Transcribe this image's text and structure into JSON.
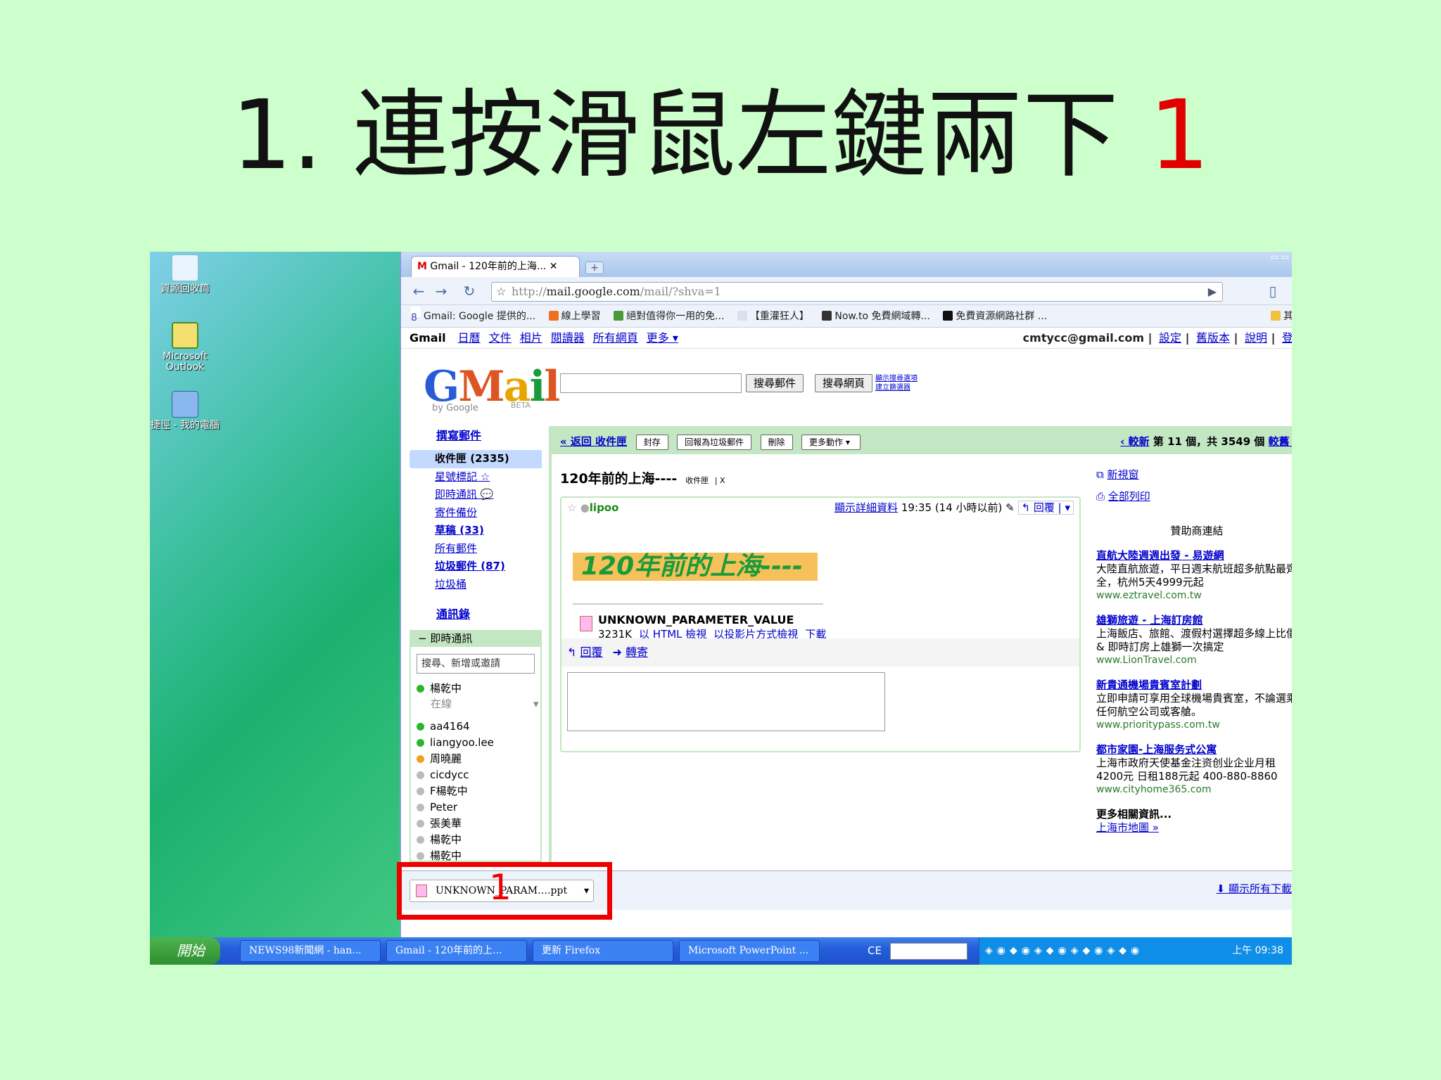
{
  "slide": {
    "title": "1. 連按滑鼠左鍵兩下 ",
    "title_number": "1"
  },
  "desktop": {
    "icons": [
      "資源回收筒",
      "Microsoft Outlook",
      "捷徑 - 我的電腦"
    ]
  },
  "browser": {
    "tab_title": "Gmail - 120年前的上海...",
    "url_prefix": "http://",
    "url_host": "mail.google.com",
    "url_path": "/mail/?shva=1",
    "bookmarks": [
      "Gmail: Google 提供的...",
      "線上學習",
      "絕對值得你一用的免...",
      "【重灌狂人】",
      "Now.to 免費網域轉...",
      "免費資源網路社群 ...",
      "其"
    ]
  },
  "gmail": {
    "gbar_links": [
      "日曆",
      "文件",
      "相片",
      "閱讀器",
      "所有網頁",
      "更多 ▾"
    ],
    "gbar_brand": "Gmail",
    "user_email": "cmtycc@gmail.com",
    "user_links": [
      "設定",
      "舊版本",
      "說明",
      "登"
    ],
    "logo": {
      "by": "by Google",
      "beta": "BETA"
    },
    "search_mail_btn": "搜尋郵件",
    "search_web_btn": "搜尋網頁",
    "search_opts": [
      "顯示搜尋選項",
      "建立篩選器"
    ],
    "compose": "撰寫郵件",
    "nav": [
      {
        "label": "收件匣 (2335)",
        "sel": true
      },
      {
        "label": "星號標記 ☆"
      },
      {
        "label": "即時通訊 💬"
      },
      {
        "label": "寄件備份"
      },
      {
        "label": "草稿 (33)",
        "bold": true
      },
      {
        "label": "所有郵件"
      },
      {
        "label": "垃圾郵件 (87)",
        "bold": true
      },
      {
        "label": "垃圾桶"
      }
    ],
    "contacts": "通訊錄",
    "chat": {
      "header": "−  即時通訊",
      "search_placeholder": "搜尋、新增或邀請",
      "me_name": "楊乾中",
      "me_status": "在線",
      "list": [
        {
          "name": "aa4164",
          "status": "on"
        },
        {
          "name": "liangyoo.lee",
          "status": "on"
        },
        {
          "name": "周曉麗",
          "status": "idle"
        },
        {
          "name": "cicdycc",
          "status": "off"
        },
        {
          "name": "F楊乾中",
          "status": "off"
        },
        {
          "name": "Peter",
          "status": "off"
        },
        {
          "name": "張美華",
          "status": "off"
        },
        {
          "name": "楊乾中",
          "status": "off"
        },
        {
          "name": "楊乾中",
          "status": "off"
        }
      ]
    },
    "toolbar": {
      "back": "« 返回 收件匣",
      "archive": "封存",
      "spam": "回報為垃圾郵件",
      "delete": "刪除",
      "more": "更多動作 ▾",
      "pager_newer": "‹ 較新",
      "pager_text": " 第 11 個，共 3549 個 ",
      "pager_older": "較舊 ›"
    },
    "message": {
      "subject": "120年前的上海----",
      "label": "收件匣",
      "label_x": "| X",
      "sender": "lipoo",
      "details_link": "顯示詳細資料",
      "time": " 19:35 (14 小時以前)",
      "reply_btn": "↰ 回覆 | ▾",
      "banner": "120年前的上海----",
      "attachment_name": "UNKNOWN_PARAMETER_VALUE",
      "attachment_size": "3231K",
      "attachment_links": [
        "以 HTML 檢視",
        "以投影片方式檢視",
        "下載"
      ],
      "reply": "回覆",
      "forward": "轉寄"
    },
    "side": {
      "new_window": "新視窗",
      "print_all": "全部列印",
      "sponsor_title": "贊助商連結",
      "ads": [
        {
          "title": "直航大陸週週出發 - 易遊網",
          "body": "大陸直航旅遊，平日週末航班超多航點最齊全，杭州5天4999元起",
          "url": "www.eztravel.com.tw"
        },
        {
          "title": "雄獅旅遊 - 上海訂房館",
          "body": "上海飯店、旅館、渡假村選擇超多線上比價 & 即時訂房上雄獅一次搞定",
          "url": "www.LionTravel.com"
        },
        {
          "title": "新貴通機場貴賓室計劃",
          "body": "立即申請可享用全球機場貴賓室，不論選乘任何航空公司或客艙。",
          "url": "www.prioritypass.com.tw"
        },
        {
          "title": "都市家園-上海服务式公寓",
          "body": "上海市政府天使基金注资创业企业月租4200元 日租188元起 400-880-8860",
          "url": "www.cityhome365.com"
        }
      ],
      "more_info": "更多相關資訊...",
      "map_link": "上海市地圖 »"
    }
  },
  "download": {
    "file": "UNKNOWN_PARAM….ppt",
    "show_all": "顯示所有下載",
    "highlight_number": "1"
  },
  "taskbar": {
    "start": "開始",
    "tasks": [
      "NEWS98新聞網 - han...",
      "Gmail - 120年前的上...",
      "更新 Firefox",
      "Microsoft PowerPoint ..."
    ],
    "ce": "CE",
    "clock": "上午 09:38"
  }
}
